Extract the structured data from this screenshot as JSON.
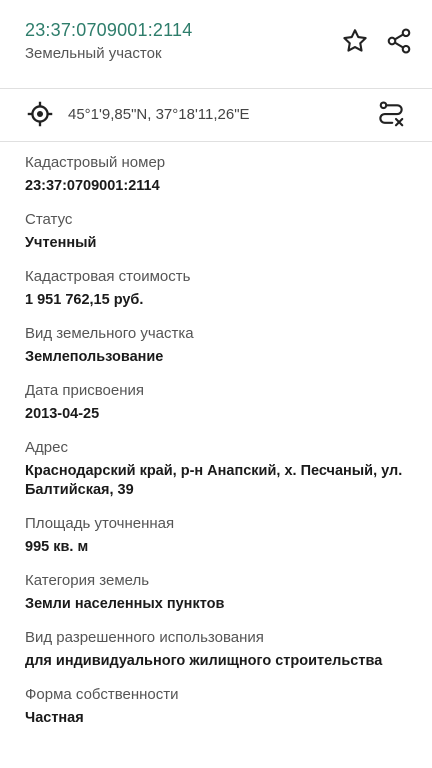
{
  "header": {
    "cadastral_number": "23:37:0709001:2114",
    "object_type": "Земельный участок"
  },
  "location": {
    "coordinates": "45°1'9,85\"N, 37°18'11,26\"E"
  },
  "fields": [
    {
      "label": "Кадастровый номер",
      "value": "23:37:0709001:2114"
    },
    {
      "label": "Статус",
      "value": "Учтенный"
    },
    {
      "label": "Кадастровая стоимость",
      "value": "1 951 762,15 руб."
    },
    {
      "label": "Вид земельного участка",
      "value": "Землепользование"
    },
    {
      "label": "Дата присвоения",
      "value": "2013-04-25"
    },
    {
      "label": "Адрес",
      "value": "Краснодарский край, р-н Анапский, х. Песчаный, ул. Балтийская, 39"
    },
    {
      "label": "Площадь уточненная",
      "value": "995 кв. м"
    },
    {
      "label": "Категория земель",
      "value": "Земли населенных пунктов"
    },
    {
      "label": "Вид разрешенного использования",
      "value": "для индивидуального жилищного строительства"
    },
    {
      "label": "Форма собственности",
      "value": "Частная"
    }
  ],
  "icons": {
    "star": "star-outline-icon",
    "share": "share-icon",
    "location": "crosshair-icon",
    "route": "route-off-icon"
  },
  "colors": {
    "accent": "#2e7d6b"
  }
}
